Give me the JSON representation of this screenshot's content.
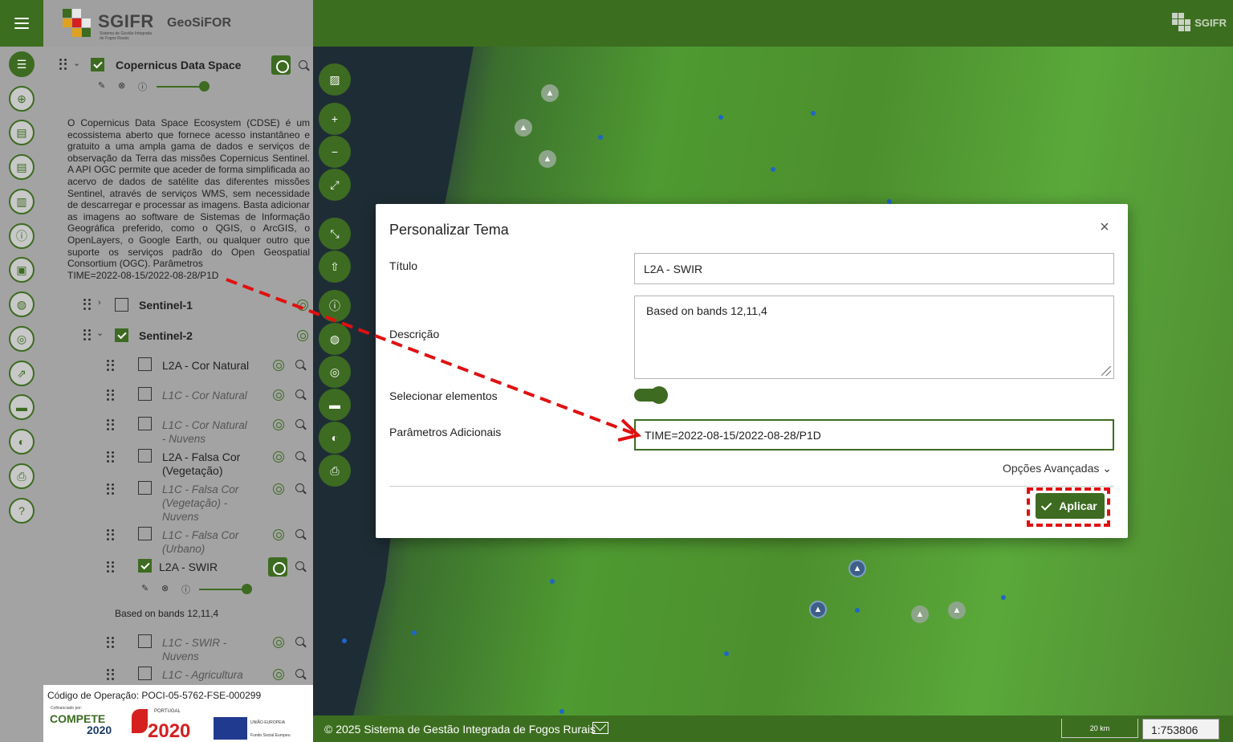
{
  "header": {
    "logo_text": "SGIFR",
    "logo_sub": "Sistema de Gestão Integrada de Fogos Rurais",
    "app_name": "GeoSiFOR",
    "corner_logo": "SGIFR"
  },
  "rail": {
    "icons": [
      "menu-icon",
      "list-icon",
      "add-layer-icon",
      "document-icon",
      "document-alt-icon",
      "map-icon",
      "info-icon",
      "id-card-icon",
      "globe-icon",
      "target-icon",
      "external-link-icon",
      "ruler-icon",
      "palette-icon",
      "print-icon",
      "help-icon"
    ]
  },
  "panel": {
    "group_title": "Copernicus Data Space",
    "group_description": "O Copernicus Data Space Ecosystem (CDSE) é um ecossistema aberto que fornece acesso instantâneo e gratuito a uma ampla gama de dados e serviços de observação da Terra das missões Copernicus Sentinel. A API OGC permite que aceder de forma simplificada ao acervo de dados de satélite das diferentes missões Sentinel, através de serviços WMS, sem necessidade de descarregar e processar as imagens. Basta adicionar as imagens ao software de Sistemas de Informação Geográfica preferido, como o QGIS, o ArcGIS, o OpenLayers, o Google Earth, ou qualquer outro que suporte os serviços padrão do Open Geospatial Consortium (OGC). Parâmetros",
    "time_param": "TIME=2022-08-15/2022-08-28/P1D",
    "sentinel1": "Sentinel-1",
    "sentinel2": "Sentinel-2",
    "layers": [
      {
        "line1": "L2A - Cor Natural",
        "line2": "",
        "line3": "",
        "italic": false,
        "checked": false
      },
      {
        "line1": "L1C - Cor Natural",
        "line2": "",
        "line3": "",
        "italic": true,
        "checked": false
      },
      {
        "line1": "L1C - Cor Natural",
        "line2": "- Nuvens",
        "line3": "",
        "italic": true,
        "checked": false
      },
      {
        "line1": "L2A - Falsa Cor",
        "line2": "(Vegetação)",
        "line3": "",
        "italic": false,
        "checked": false
      },
      {
        "line1": "L1C - Falsa Cor",
        "line2": "(Vegetação) -",
        "line3": "Nuvens",
        "italic": true,
        "checked": false
      },
      {
        "line1": "L1C - Falsa Cor",
        "line2": "(Urbano)",
        "line3": "",
        "italic": true,
        "checked": false
      },
      {
        "line1": "L2A - SWIR",
        "line2": "",
        "line3": "",
        "italic": false,
        "checked": true
      },
      {
        "line1": "L1C - SWIR -",
        "line2": "Nuvens",
        "line3": "",
        "italic": true,
        "checked": false
      },
      {
        "line1": "L1C - Agricultura",
        "line2": "",
        "line3": "",
        "italic": true,
        "checked": false
      }
    ],
    "swir_description": "Based on bands 12,11,4",
    "group_opacity": 1.0,
    "swir_opacity": 1.0
  },
  "footer_left": {
    "op_code": "Código de Operação: POCI-05-5762-FSE-000299",
    "cofin": "Cofinanciado por:",
    "compete": "COMPETE",
    "compete_year": "2020",
    "portugal": "PORTUGAL",
    "portugal_year": "2020",
    "eu": "UNIÃO EUROPEIA",
    "eu_fund": "Fundo Social Europeu"
  },
  "map": {
    "controls": [
      "image-icon",
      "zoom-in-icon",
      "zoom-out-icon",
      "fit-extent-icon",
      "collapse-icon",
      "up-icon",
      "info-icon",
      "globe-icon",
      "target-icon",
      "ruler-icon",
      "palette-icon",
      "print-icon"
    ],
    "zoom_in": "+",
    "zoom_out": "−"
  },
  "bottom_bar": {
    "copyright": "© 2025 Sistema de Gestão Integrada de Fogos Rurais",
    "scale_label": "20 km",
    "scale_value": "1:753806"
  },
  "modal": {
    "title": "Personalizar Tema",
    "label_title": "Título",
    "title_value": "L2A - SWIR",
    "label_desc": "Descrição",
    "desc_value": "Based on bands 12,11,4",
    "label_select": "Selecionar elementos",
    "select_enabled": true,
    "label_params": "Parâmetros Adicionais",
    "params_value": "TIME=2022-08-15/2022-08-28/P1D",
    "advanced": "Opções Avançadas",
    "apply": "Aplicar"
  },
  "colors": {
    "brand_green": "#3d6b21",
    "highlight_red": "#e01010"
  }
}
